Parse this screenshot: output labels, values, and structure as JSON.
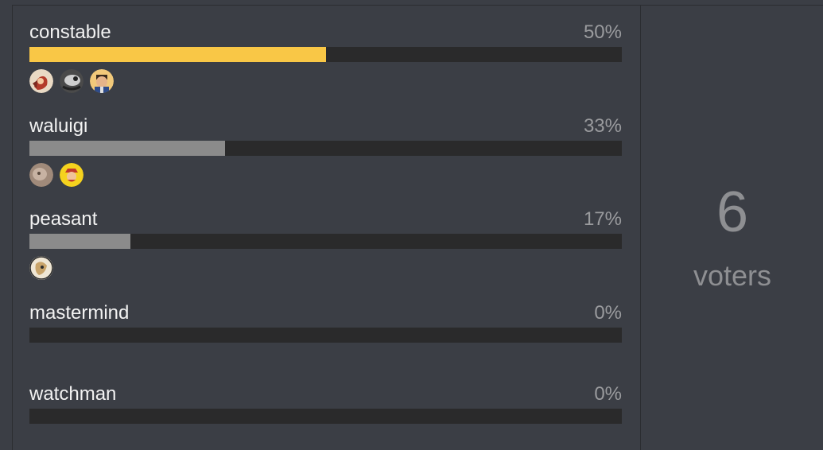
{
  "poll": {
    "options": [
      {
        "label": "constable",
        "percent": "50%",
        "fraction": 0.5,
        "winner": true,
        "voters": [
          "avatar-1",
          "avatar-2",
          "avatar-3"
        ]
      },
      {
        "label": "waluigi",
        "percent": "33%",
        "fraction": 0.33,
        "winner": false,
        "voters": [
          "avatar-4",
          "avatar-5"
        ]
      },
      {
        "label": "peasant",
        "percent": "17%",
        "fraction": 0.17,
        "winner": false,
        "voters": [
          "avatar-6"
        ]
      },
      {
        "label": "mastermind",
        "percent": "0%",
        "fraction": 0,
        "winner": false,
        "voters": []
      },
      {
        "label": "watchman",
        "percent": "0%",
        "fraction": 0,
        "winner": false,
        "voters": []
      }
    ],
    "total": "6",
    "total_label": "voters"
  },
  "colors": {
    "background": "#3b3e45",
    "winner_bar": "#f9c746",
    "other_bar": "#8b8b8b",
    "track": "#2a2a2b"
  }
}
